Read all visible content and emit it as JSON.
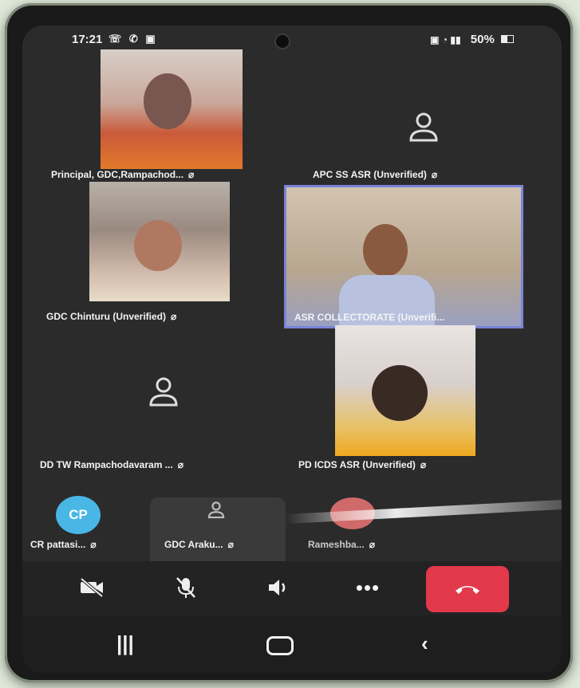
{
  "status_bar": {
    "time": "17:21",
    "battery": "50%"
  },
  "tiles": {
    "principal": {
      "name": "Principal, GDC,Rampachod..."
    },
    "apc": {
      "name": "APC SS ASR (Unverified)"
    },
    "chinturu": {
      "name": "GDC Chinturu (Unverified)"
    },
    "collectorate": {
      "name": "ASR COLLECTORATE (Unverifi..."
    },
    "ddtw": {
      "name": "DD TW Rampachodavaram ..."
    },
    "pdicds": {
      "name": "PD ICDS ASR (Unverified)"
    }
  },
  "strip": {
    "cr": {
      "initials": "CP",
      "name": "CR pattasi..."
    },
    "araku": {
      "name": "GDC Araku..."
    },
    "ramesh": {
      "name": "Rameshba..."
    }
  },
  "colors": {
    "end_call": "#e2394b",
    "active_speaker_border": "#7b84d8",
    "avatar_cp": "#48b7e6"
  }
}
